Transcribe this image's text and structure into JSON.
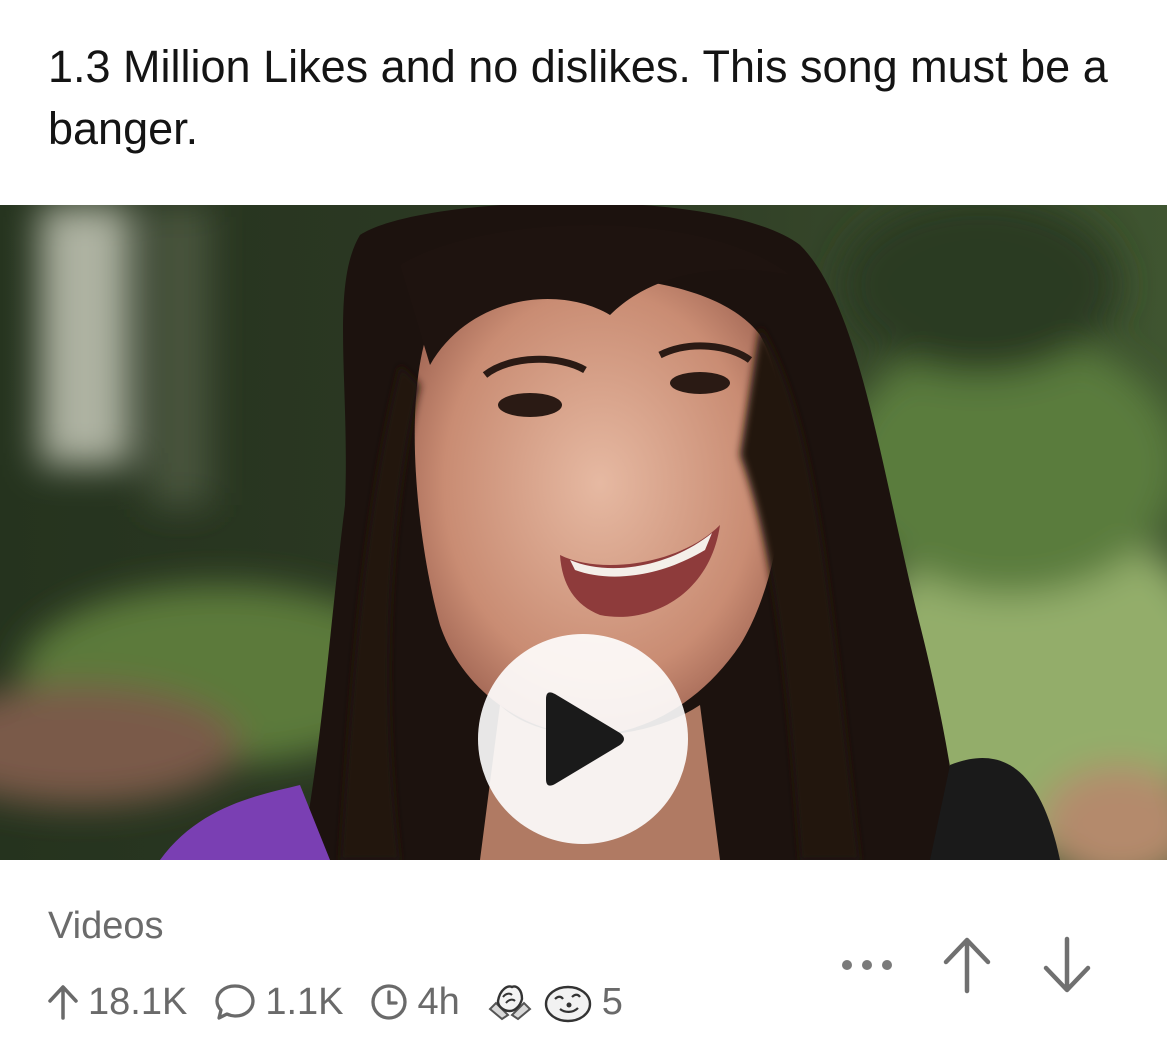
{
  "post": {
    "title": "1.3 Million Likes and no dislikes. This song must be a banger.",
    "flair": "Videos"
  },
  "media": {
    "type": "video-thumbnail",
    "play_icon": "play-icon"
  },
  "stats": {
    "upvotes": "18.1K",
    "comments": "1.1K",
    "age": "4h",
    "award_count": "5"
  },
  "icons": {
    "upvote": "arrow-up-icon",
    "comment": "comment-bubble-icon",
    "time": "clock-icon",
    "award_1": "handshake-award-icon",
    "award_2": "seal-award-icon",
    "more": "more-dots-icon",
    "vote_up": "upvote-arrow-icon",
    "vote_down": "downvote-arrow-icon"
  },
  "colors": {
    "text_primary": "#141414",
    "text_secondary": "#6a6a6a"
  }
}
